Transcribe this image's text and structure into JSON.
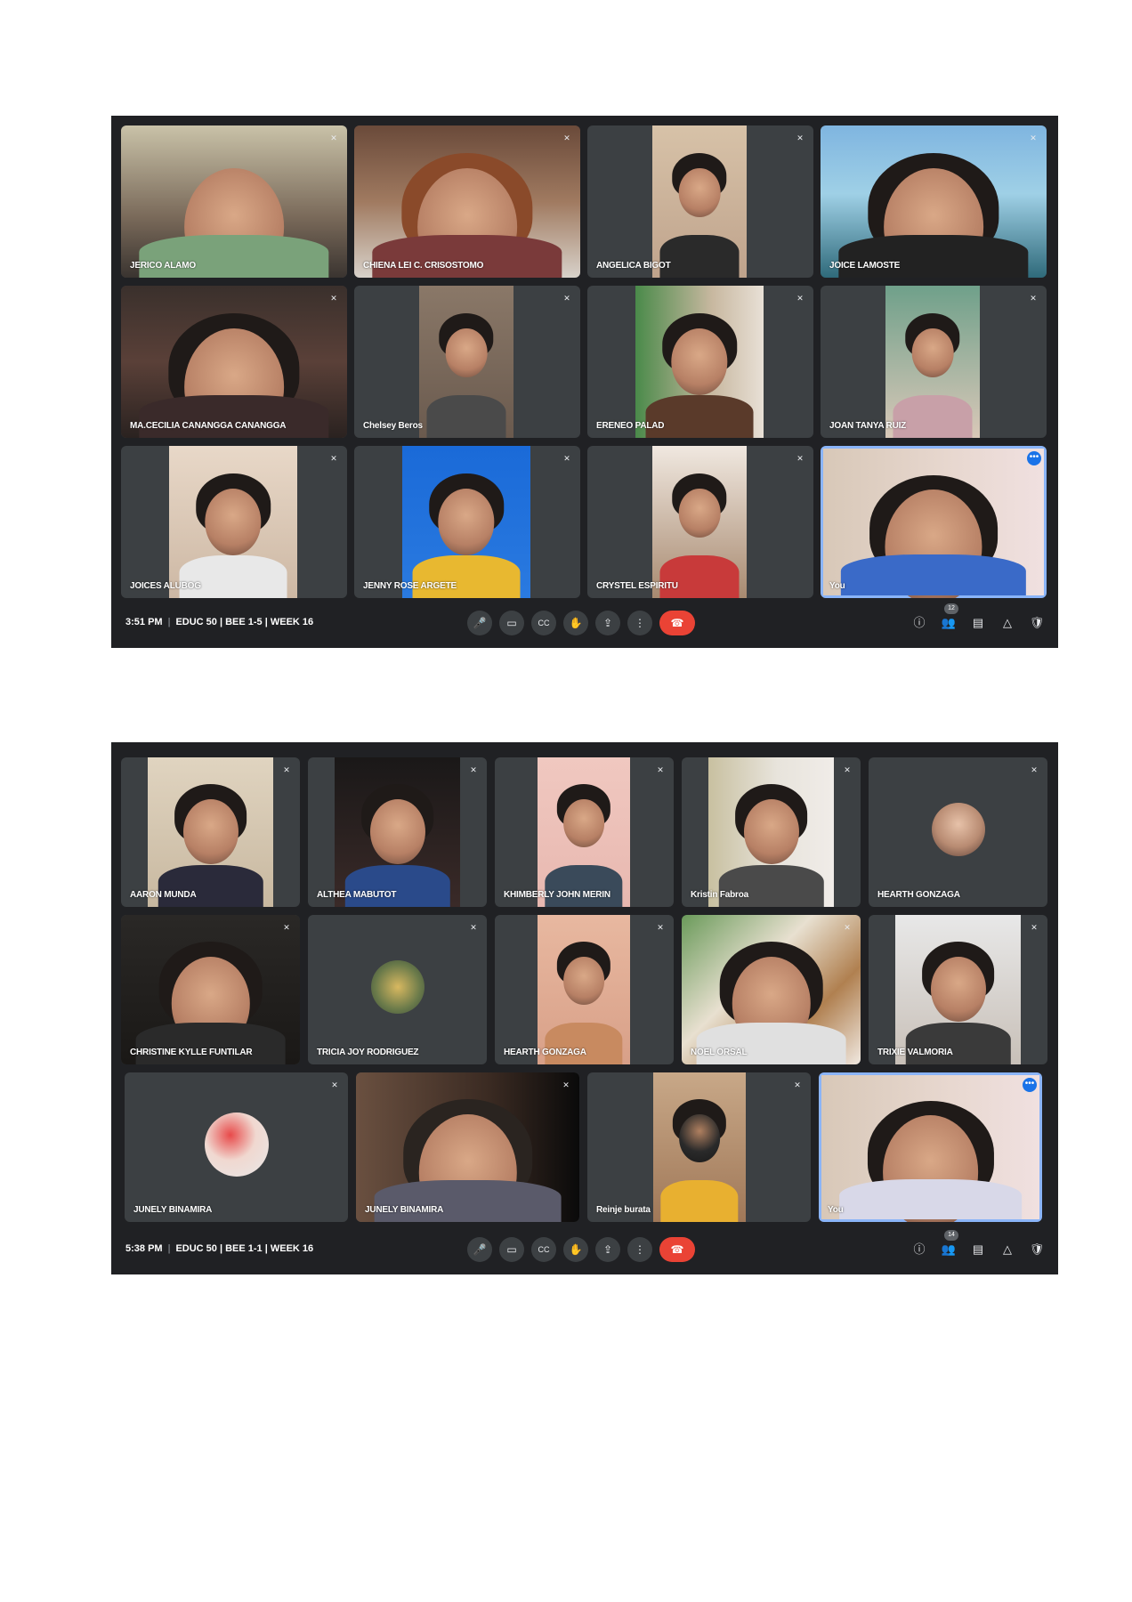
{
  "icons": {
    "mic_off": "✕",
    "mic": "🎤",
    "camera": "▭",
    "captions": "CC",
    "hand": "✋",
    "present": "⇪",
    "more": "⋮",
    "hangup": "☎",
    "info": "ⓘ",
    "people": "👥",
    "chat": "▤",
    "activities": "△",
    "host": "🛡",
    "tile_more": "•••"
  },
  "colors": {
    "background": "#202124",
    "tile": "#3c4043",
    "hangup": "#ea4335",
    "self_border": "#8ab4f8"
  },
  "meetings": [
    {
      "time": "3:51 PM",
      "meeting_name": "EDUC 50 | BEE 1-5 | WEEK 16",
      "participant_count": "12",
      "tiles": [
        {
          "name": "JERICO ALAMO",
          "type": "video"
        },
        {
          "name": "CHIENA LEI C. CRISOSTOMO",
          "type": "video"
        },
        {
          "name": "ANGELICA BIGOT",
          "type": "video"
        },
        {
          "name": "JOICE LAMOSTE",
          "type": "video"
        },
        {
          "name": "MA.CECILIA CANANGGA CANANGGA",
          "type": "video"
        },
        {
          "name": "Chelsey Beros",
          "type": "video"
        },
        {
          "name": "ERENEO PALAD",
          "type": "video"
        },
        {
          "name": "JOAN TANYA RUIZ",
          "type": "video"
        },
        {
          "name": "JOICES ALUBOG",
          "type": "video"
        },
        {
          "name": "JENNY ROSE ARGETE",
          "type": "video"
        },
        {
          "name": "CRYSTEL ESPIRITU",
          "type": "video"
        },
        {
          "name": "You",
          "type": "video",
          "self": true
        }
      ]
    },
    {
      "time": "5:38 PM",
      "meeting_name": "EDUC 50 | BEE 1-1 | WEEK 16",
      "participant_count": "14",
      "tiles": [
        {
          "name": "AARON MUNDA",
          "type": "video"
        },
        {
          "name": "ALTHEA MABUTOT",
          "type": "video"
        },
        {
          "name": "KHIMBERLY JOHN MERIN",
          "type": "video"
        },
        {
          "name": "Kristin Fabroa",
          "type": "video"
        },
        {
          "name": "HEARTH GONZAGA",
          "type": "avatar"
        },
        {
          "name": "CHRISTINE KYLLE FUNTILAR",
          "type": "video"
        },
        {
          "name": "TRICIA JOY RODRIGUEZ",
          "type": "avatar"
        },
        {
          "name": "HEARTH GONZAGA",
          "type": "video"
        },
        {
          "name": "NOEL ORSAL",
          "type": "video"
        },
        {
          "name": "TRIXIE VALMORIA",
          "type": "video"
        },
        {
          "name": "JUNELY BINAMIRA",
          "type": "avatar"
        },
        {
          "name": "JUNELY BINAMIRA",
          "type": "video"
        },
        {
          "name": "Reinje burata",
          "type": "video"
        },
        {
          "name": "You",
          "type": "video",
          "self": true
        }
      ]
    }
  ]
}
